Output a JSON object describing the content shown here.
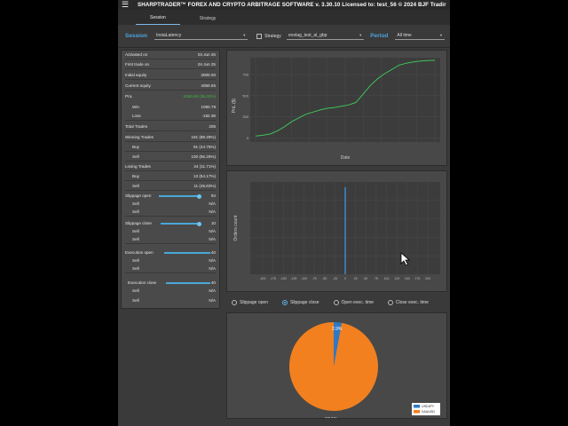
{
  "window": {
    "menu_glyph": "☰",
    "title": "SHARPTRADER™ FOREX AND CRYPTO ARBITRAGE SOFTWARE v. 3.30.10 Licensed to: test_56 © 2024 BJF Tradir"
  },
  "tabs": [
    {
      "label": "Session",
      "active": true
    },
    {
      "label": "Strategy",
      "active": false
    }
  ],
  "toolbar": {
    "session_label": "Session",
    "session_value": "InstaLatency",
    "strategy_label": "Strategy",
    "strategy_value": "onelag_test_al_gbp",
    "period_label": "Period",
    "period_value": "All time"
  },
  "stats": {
    "activated_on": {
      "label": "Activated on",
      "value": "03 Jun 25"
    },
    "first_trade_on": {
      "label": "First trade on",
      "value": "04 Jun 25"
    },
    "initial_equity": {
      "label": "Initial equity",
      "value": "3000.00"
    },
    "current_equity": {
      "label": "Current equity",
      "value": "4050.65"
    },
    "pnl": {
      "label": "PnL",
      "value": "1050.65 (35.02%)"
    },
    "win": {
      "label": "Win",
      "value": "1090.79"
    },
    "loss": {
      "label": "Loss",
      "value": "-182.38"
    },
    "total_trades": {
      "label": "Total Trades",
      "value": "205"
    },
    "winning_trades": {
      "label": "Winning Trades",
      "value": "181 (88.29%)"
    },
    "winning_buy": {
      "label": "Buy",
      "value": "81 (44.75%)"
    },
    "winning_sell": {
      "label": "Sell",
      "value": "100 (55.25%)"
    },
    "losing_trades": {
      "label": "Losing Trades",
      "value": "24 (11.71%)"
    },
    "losing_buy": {
      "label": "Buy",
      "value": "13 (54.17%)"
    },
    "losing_sell": {
      "label": "Sell",
      "value": "11 (45.83%)"
    }
  },
  "sliders": {
    "slippage_open": {
      "label": "Slippage open",
      "value": "94",
      "level": 0.85,
      "sell_label": "Sell",
      "sell_value": "N/A",
      "sell2_label": "Sell",
      "sell2_value": "N/A"
    },
    "slippage_close": {
      "label": "Slippage close",
      "value": "10",
      "level": 0.85,
      "sell_label": "Sell",
      "sell_value": "N/A",
      "sell2_label": "Sell",
      "sell2_value": "N/A"
    },
    "execution_open": {
      "label": "Execution open",
      "value": "40",
      "level": 0.95,
      "sell_label": "Sell",
      "sell_value": "N/A",
      "sell2_label": "Sell",
      "sell2_value": "N/A"
    },
    "execution_close": {
      "label": "Execution close",
      "value": "40",
      "level": 0.95,
      "sell_label": "Sell",
      "sell_value": "N/A",
      "sell2_label": "Sell",
      "sell2_value": "N/A"
    }
  },
  "radios": [
    {
      "label": "Slippage open",
      "selected": false
    },
    {
      "label": "Slippage close",
      "selected": true
    },
    {
      "label": "Open exec. time",
      "selected": false
    },
    {
      "label": "Close exec. time",
      "selected": false
    }
  ],
  "chart_data": [
    {
      "type": "line",
      "ylabel": "PnL ($)",
      "xlabel": "Date",
      "y_ticks": [
        "750",
        "500",
        "250",
        "0"
      ],
      "ylim": [
        -50,
        950
      ],
      "series": [
        {
          "color": "#3ec25a",
          "x": [
            0,
            4,
            8,
            12,
            16,
            20,
            24,
            28,
            32,
            36,
            40,
            44,
            48,
            52,
            56,
            60,
            64,
            68,
            72,
            76,
            80,
            84,
            88,
            92,
            96,
            100
          ],
          "values": [
            20,
            30,
            45,
            80,
            130,
            190,
            235,
            280,
            305,
            330,
            350,
            360,
            375,
            390,
            420,
            520,
            620,
            700,
            760,
            810,
            860,
            885,
            900,
            910,
            915,
            918
          ]
        }
      ]
    },
    {
      "type": "bar",
      "ylabel": "Orders count",
      "xlim": [
        -230,
        230
      ],
      "x_ticks": [
        "-200",
        "-175",
        "-150",
        "-125",
        "-100",
        "-75",
        "-50",
        "-25",
        "0",
        "25",
        "50",
        "75",
        "100",
        "125",
        "150",
        "175",
        "200"
      ],
      "series": [
        {
          "color": "#3b8fd8",
          "x": [
            0
          ],
          "values": [
            195
          ]
        }
      ]
    },
    {
      "type": "pie",
      "legend": [
        "USDJPY",
        "XAUUSD"
      ],
      "legend_position": "bottom-right",
      "slices": [
        {
          "label": "USDJPY",
          "value": 2.9,
          "text": "2.9%",
          "color": "#2f79c4"
        },
        {
          "label": "XAUUSD",
          "value": 97.1,
          "text": "97.1%",
          "color": "#f2801f"
        }
      ]
    }
  ]
}
